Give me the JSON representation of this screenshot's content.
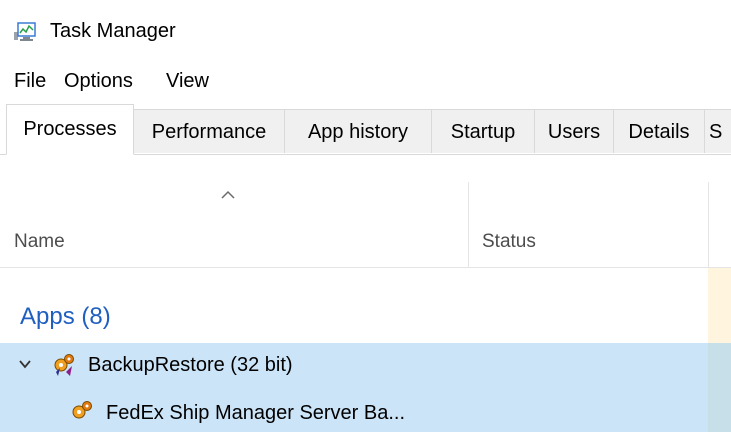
{
  "window": {
    "title": "Task Manager"
  },
  "menu": {
    "items": [
      "File",
      "Options",
      "View"
    ]
  },
  "tabs": [
    {
      "label": "Processes",
      "active": true
    },
    {
      "label": "Performance",
      "active": false
    },
    {
      "label": "App history",
      "active": false
    },
    {
      "label": "Startup",
      "active": false
    },
    {
      "label": "Users",
      "active": false
    },
    {
      "label": "Details",
      "active": false
    },
    {
      "label": "S",
      "active": false
    }
  ],
  "columns": {
    "name": "Name",
    "status": "Status",
    "sort_indicator": "^"
  },
  "groups": {
    "apps_label": "Apps (8)"
  },
  "processes": [
    {
      "name": "BackupRestore (32 bit)",
      "expanded": true,
      "icon": "gears-icon"
    },
    {
      "name": "FedEx Ship Manager Server Ba...",
      "child": true,
      "icon": "gears-icon"
    }
  ],
  "colors": {
    "group_text": "#1f5fbf",
    "selected_row": "#cce4f7",
    "cpu_heat": "#fff4dd"
  }
}
